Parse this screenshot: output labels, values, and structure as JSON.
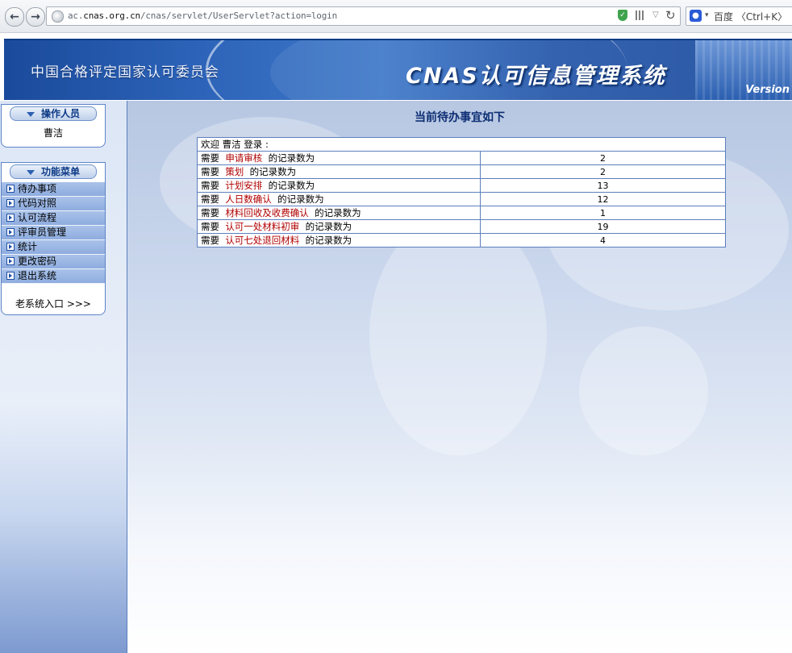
{
  "browser": {
    "url_prefix": "ac.",
    "url_host": "cnas.org.cn",
    "url_path": "/cnas/servlet/UserServlet?action=login",
    "search_label": "百度 〈Ctrl+K〉"
  },
  "banner": {
    "org_name": "中国合格评定国家认可委员会",
    "system_name": "CNAS认可信息管理系统",
    "version_label": "Version"
  },
  "sidebar": {
    "operator_title": "操作人员",
    "operator_name": "曹洁",
    "menu_title": "功能菜单",
    "menu_items": [
      "待办事项",
      "代码对照",
      "认可流程",
      "评审员管理",
      "统计",
      "更改密码",
      "退出系统"
    ],
    "old_system_link": "老系统入口 >>>"
  },
  "main": {
    "title": "当前待办事宜如下",
    "welcome": "欢迎 曹洁 登录 :",
    "prefix": "需要",
    "suffix": "的记录数为",
    "rows": [
      {
        "item": "申请审核",
        "count": "2"
      },
      {
        "item": "策划",
        "count": "2"
      },
      {
        "item": "计划安排",
        "count": "13"
      },
      {
        "item": "人日数确认",
        "count": "12"
      },
      {
        "item": "材料回收及收费确认",
        "count": "1"
      },
      {
        "item": "认可一处材料初审",
        "count": "19"
      },
      {
        "item": "认可七处退回材料",
        "count": "4"
      }
    ]
  }
}
